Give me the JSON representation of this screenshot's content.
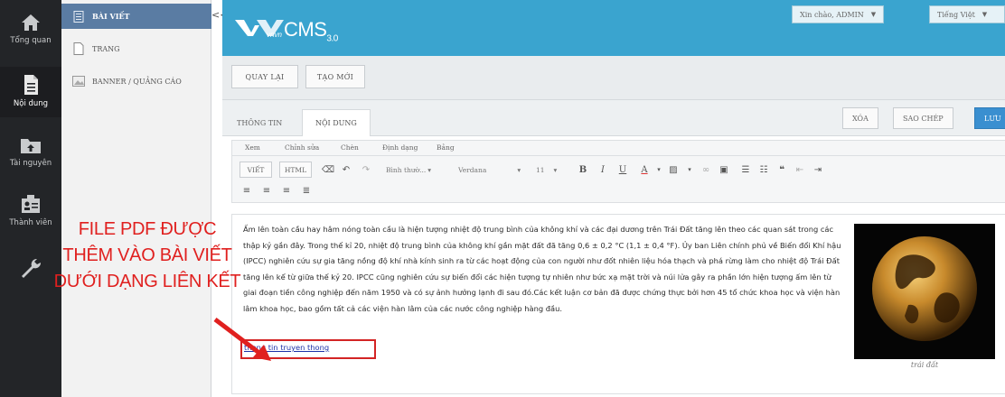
{
  "rail": {
    "items": [
      {
        "label": "Tổng quan",
        "icon": "home-icon"
      },
      {
        "label": "Nội dung",
        "icon": "document-icon"
      },
      {
        "label": "Tài nguyên",
        "icon": "folder-upload-icon"
      },
      {
        "label": "Thành viên",
        "icon": "members-icon"
      },
      {
        "label": "",
        "icon": "wrench-icon"
      }
    ]
  },
  "subnav": {
    "items": [
      {
        "label": "BÀI VIẾT",
        "icon": "article-icon"
      },
      {
        "label": "TRANG",
        "icon": "page-icon"
      },
      {
        "label": "BANNER / QUẢNG CÁO",
        "icon": "image-icon"
      }
    ],
    "collapse": "<<"
  },
  "header": {
    "logo_brand": "CMS",
    "logo_version": "3.0",
    "logo_small": "vnvn",
    "greeting": "Xin chào, ADMIN",
    "language": "Tiếng Việt"
  },
  "toolbar": {
    "back_label": "QUAY LẠI",
    "new_label": "TẠO MỚI"
  },
  "tabs": {
    "info_label": "THÔNG TIN",
    "content_label": "NỘI DUNG",
    "delete_label": "XÓA",
    "copy_label": "SAO CHÉP",
    "save_label": "LƯU"
  },
  "menubar": {
    "items": [
      "Xem",
      "Chỉnh sửa",
      "Chèn",
      "Định dạng",
      "Bảng"
    ]
  },
  "editor": {
    "mode_visual": "VIẾT",
    "mode_html": "HTML",
    "format_select": "Bình thườ...",
    "font_select": "Verdana",
    "size_select": "11",
    "bold": "B",
    "italic": "I",
    "underline": "U",
    "text_color": "A",
    "paragraph": "Ấm lên toàn cầu hay hâm nóng toàn cầu là hiện tượng nhiệt độ trung bình của không khí và các đại dương trên Trái Đất tăng lên theo các quan sát trong các thập kỷ gần đây. Trong thế kỉ 20, nhiệt độ trung bình của không khí gần mặt đất đã tăng 0,6 ± 0,2 °C (1,1 ± 0,4 °F). Ủy ban Liên chính phủ về Biến đổi Khí hậu (IPCC) nghiên cứu sự gia tăng nồng độ khí nhà kính sinh ra từ các hoạt động của con người như đốt nhiên liệu hóa thạch và phá rừng làm cho nhiệt độ Trái Đất tăng lên kể từ giữa thế kỷ 20. IPCC cũng nghiên cứu sự biến đổi các hiện tượng tự nhiên như bức xạ mặt trời và núi lửa gây ra phần lớn hiện tượng ấm lên từ giai đoạn tiền công nghiệp đến năm 1950 và có sự ảnh hưởng lạnh đi sau đó.Các kết luận cơ bản đã được chứng thực bởi hơn 45 tổ chức khoa học và viện hàn lâm khoa học, bao gồm tất cả các viện hàn lâm của các nước công nghiệp hàng đầu.",
    "link_text": "thong tin truyen thong",
    "image_caption": "trái đất"
  },
  "annotation": {
    "line1": "FILE PDF ĐƯỢC",
    "line2": "THÊM VÀO BÀI VIẾT",
    "line3": "DƯỚI DẠNG LIÊN KẾT"
  },
  "colors": {
    "rail_bg": "#232528",
    "header_bg": "#3aa4cf",
    "subnav_active": "#5a7ca3",
    "primary_button": "#3a8fd0",
    "annotation": "#e0201f",
    "link": "#1c31a8"
  }
}
